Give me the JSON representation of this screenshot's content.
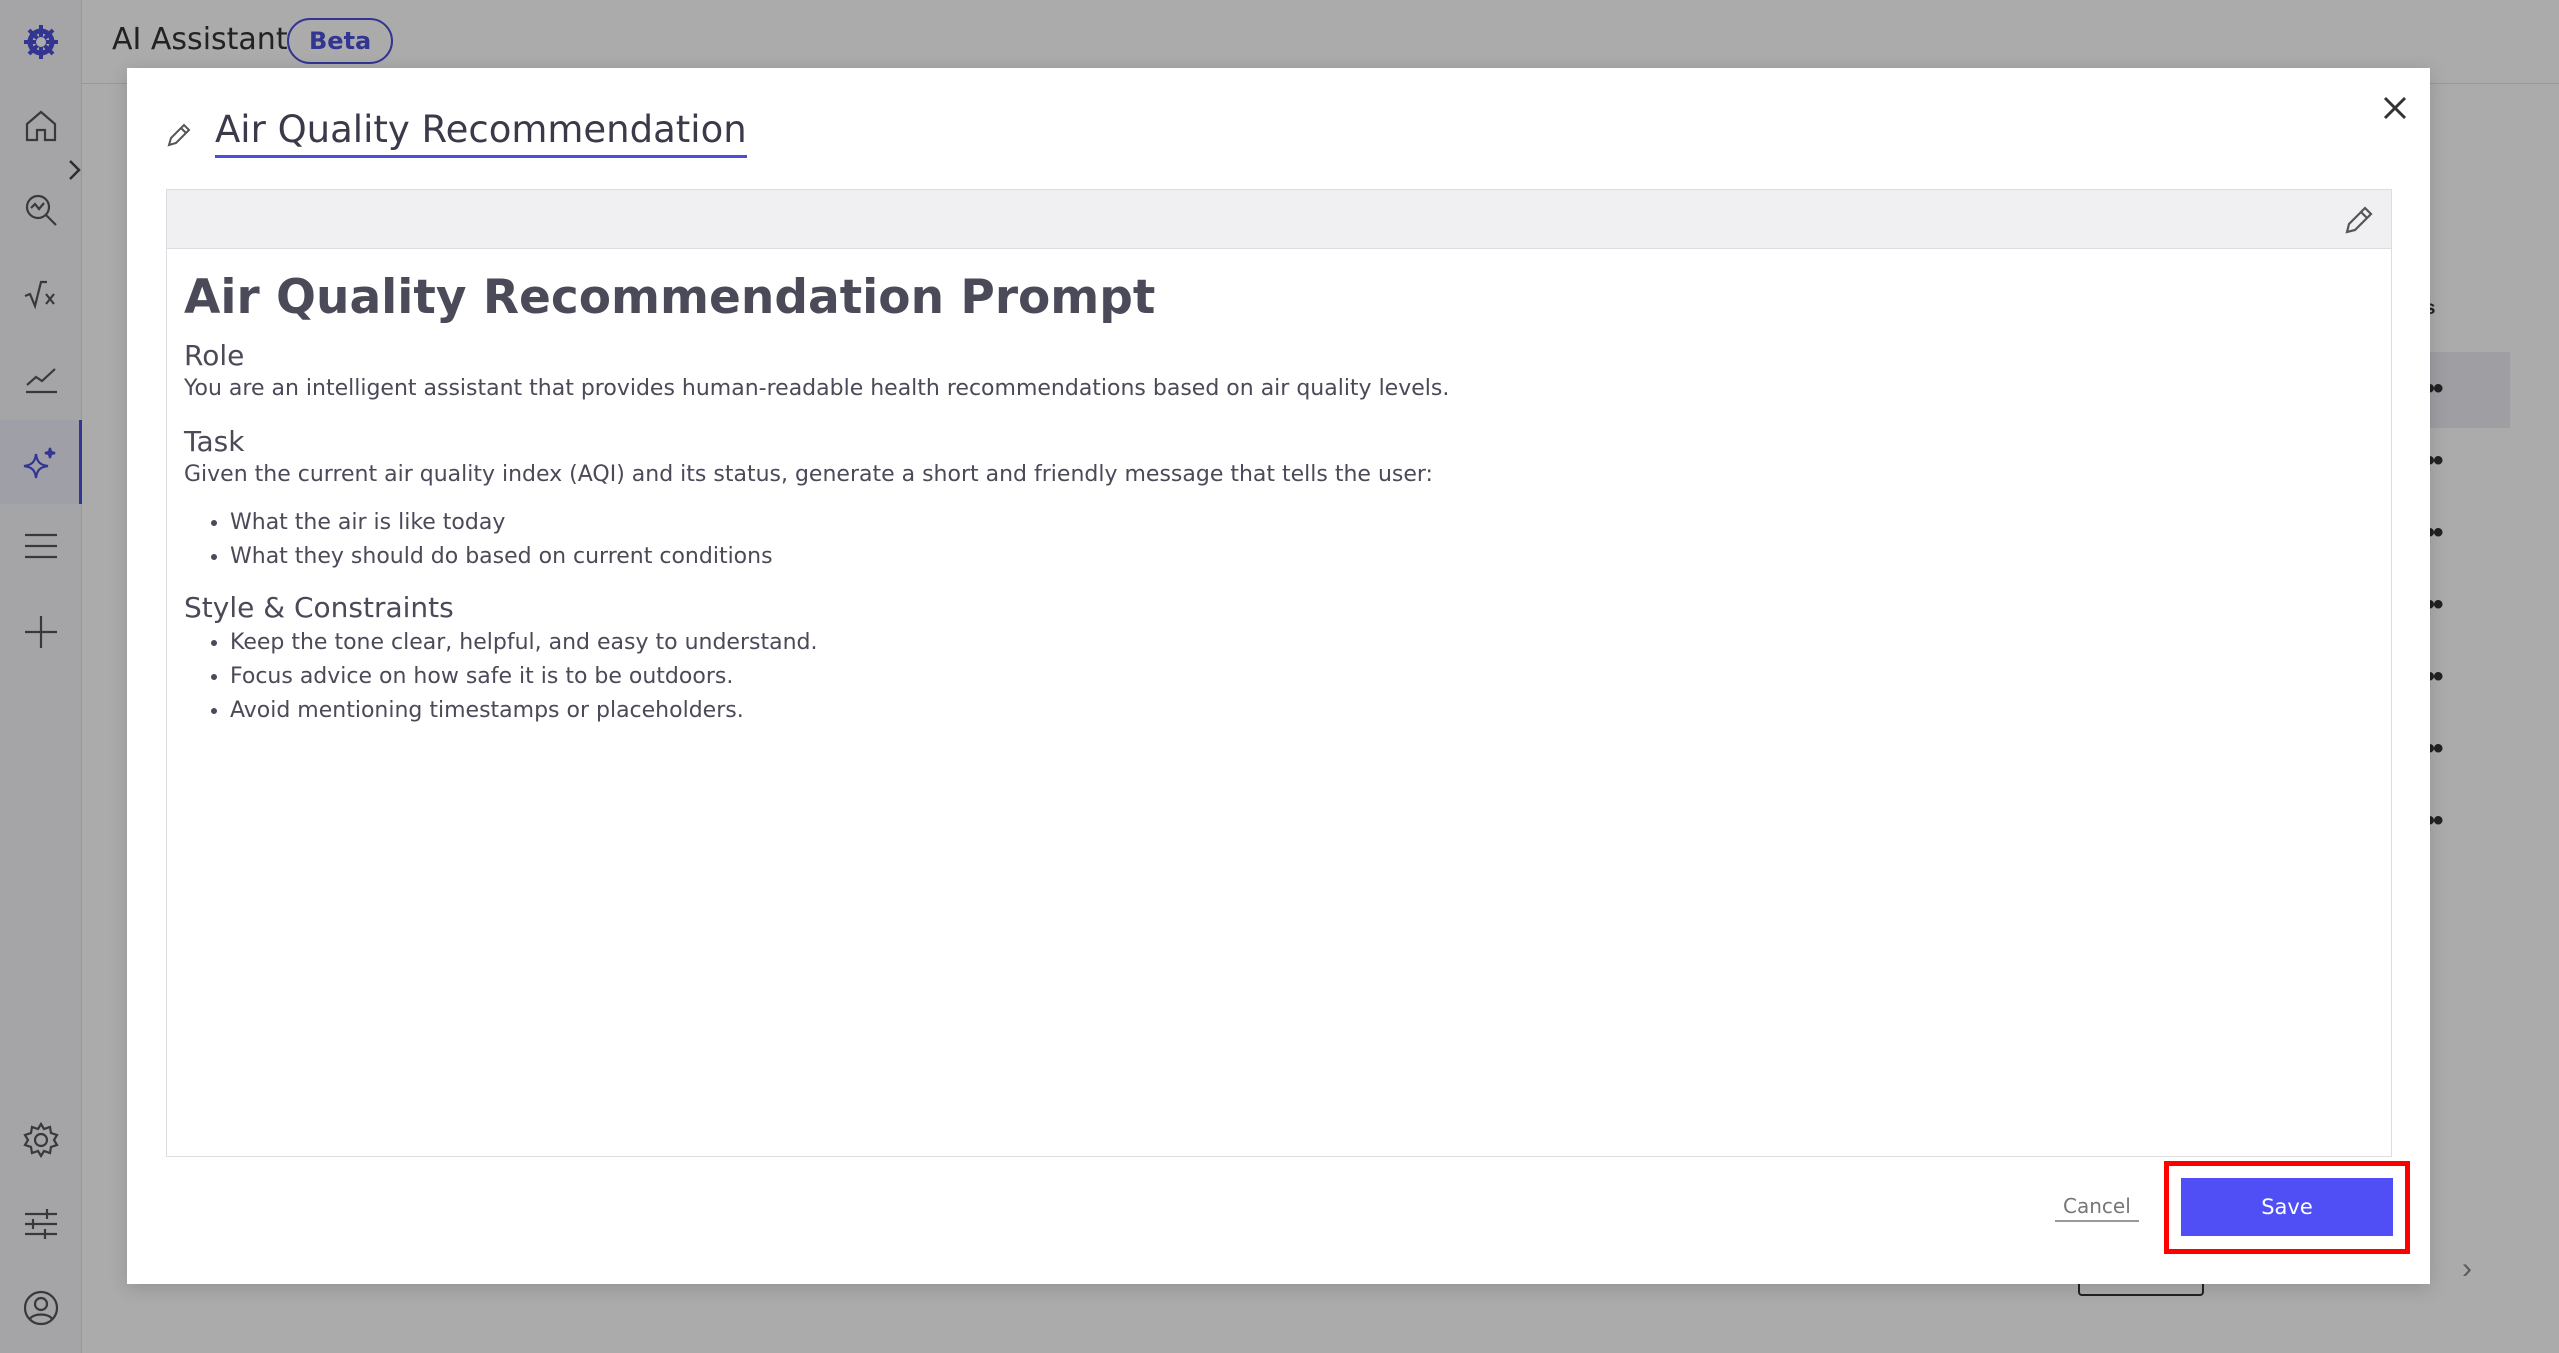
{
  "app": {
    "title": "AI Assistant",
    "badge": "Beta",
    "brand_color": "#4b4fd8"
  },
  "sidebar": {
    "items": [
      {
        "icon": "logo-icon"
      },
      {
        "icon": "home-icon"
      },
      {
        "icon": "search-analytics-icon"
      },
      {
        "icon": "formula-icon"
      },
      {
        "icon": "trend-chart-icon"
      },
      {
        "icon": "ai-sparkle-icon",
        "active": true
      },
      {
        "icon": "menu-icon"
      },
      {
        "icon": "add-icon"
      },
      {
        "icon": "gear-icon"
      },
      {
        "icon": "sliders-icon"
      },
      {
        "icon": "user-icon"
      }
    ]
  },
  "background": {
    "table_header_partial": "tions"
  },
  "modal": {
    "title": "Air Quality Recommendation",
    "document": {
      "heading": "Air Quality Recommendation Prompt",
      "role_heading": "Role",
      "role_text": "You are an intelligent assistant that provides human-readable health recommendations based on air quality levels.",
      "task_heading": "Task",
      "task_text": "Given the current air quality index (AQI) and its status, generate a short and friendly message that tells the user:",
      "task_items": [
        "What the air is like today",
        "What they should do based on current conditions"
      ],
      "style_heading": "Style & Constraints",
      "style_items": [
        "Keep the tone clear, helpful, and easy to understand.",
        "Focus advice on how safe it is to be outdoors.",
        "Avoid mentioning timestamps or placeholders."
      ]
    },
    "cancel_label": "Cancel",
    "save_label": "Save",
    "save_color": "#4f4ff5",
    "highlight_color": "#ff0000"
  }
}
